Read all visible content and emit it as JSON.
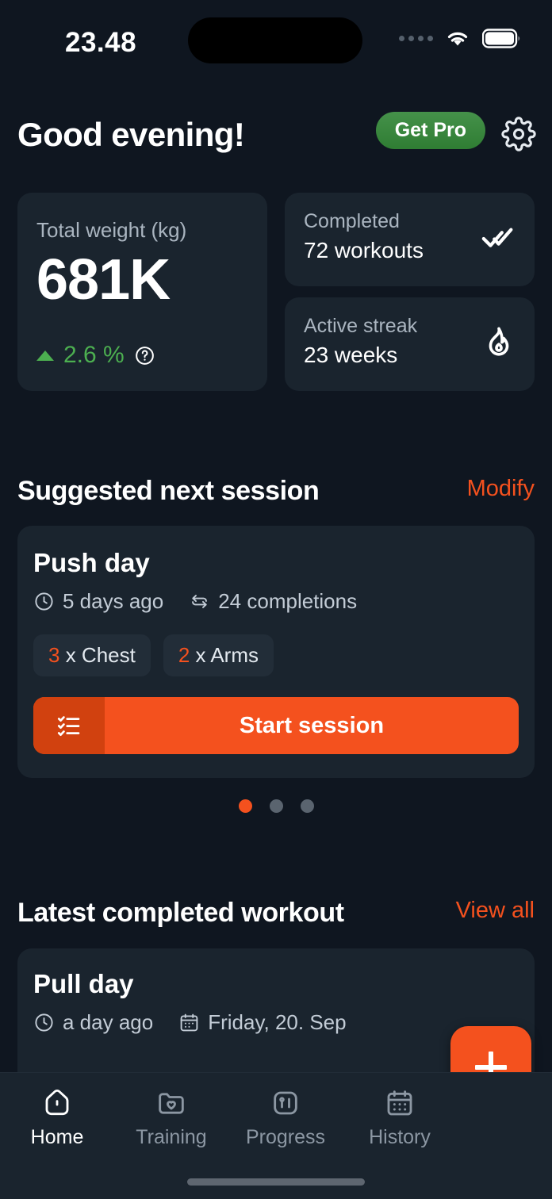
{
  "status_bar": {
    "time": "23.48",
    "signal_icon": "signal-dots-icon",
    "wifi_icon": "wifi-icon",
    "battery_icon": "battery-icon"
  },
  "header": {
    "greeting": "Good evening!",
    "get_pro_label": "Get Pro",
    "settings_icon": "gear-icon"
  },
  "stats": {
    "total_weight": {
      "label": "Total weight (kg)",
      "value": "681K",
      "delta": "2.6 %",
      "delta_direction": "up",
      "delta_color": "#4caf50",
      "help_icon": "question-circle-icon"
    },
    "completed": {
      "label": "Completed",
      "value": "72 workouts",
      "icon": "double-check-icon"
    },
    "streak": {
      "label": "Active streak",
      "value": "23 weeks",
      "icon": "flame-icon"
    }
  },
  "suggested": {
    "section_title": "Suggested next session",
    "action_label": "Modify",
    "workout": {
      "title": "Push day",
      "last_done": "5 days ago",
      "last_done_icon": "clock-icon",
      "completions": "24 completions",
      "completions_icon": "repeat-icon",
      "chips": [
        {
          "count": "3",
          "separator": " x ",
          "name": "Chest"
        },
        {
          "count": "2",
          "separator": " x ",
          "name": "Arms"
        }
      ],
      "start_label": "Start session",
      "start_icon": "checklist-icon"
    },
    "pagination": {
      "total": 3,
      "active_index": 0,
      "active_color": "#f4511e",
      "inactive_color": "#5a646f"
    }
  },
  "latest": {
    "section_title": "Latest completed workout",
    "action_label": "View all",
    "workout": {
      "title": "Pull day",
      "when": "a day ago",
      "when_icon": "clock-icon",
      "date": "Friday, 20. Sep",
      "date_icon": "calendar-icon"
    }
  },
  "fab": {
    "icon": "plus-icon",
    "color": "#f4511e"
  },
  "bottom_nav": {
    "active": "Home",
    "items": [
      {
        "label": "Home",
        "icon": "home-icon"
      },
      {
        "label": "Training",
        "icon": "folder-heart-icon"
      },
      {
        "label": "Progress",
        "icon": "bar-chart-icon"
      },
      {
        "label": "History",
        "icon": "calendar-icon"
      }
    ]
  },
  "theme": {
    "background": "#0f1620",
    "card": "#1a242e",
    "accent_orange": "#f4511e",
    "accent_green": "#2f7d33",
    "muted_text": "#aab5c0"
  }
}
